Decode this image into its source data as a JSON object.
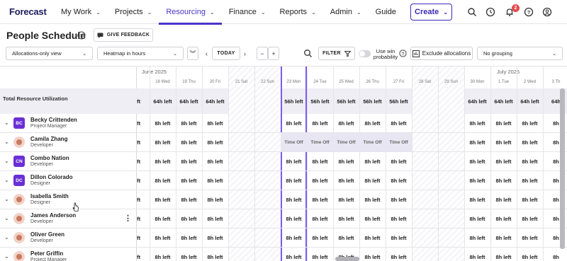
{
  "app": {
    "logo": "Forecast"
  },
  "nav": [
    {
      "label": "My Work",
      "has_dropdown": true
    },
    {
      "label": "Projects",
      "has_dropdown": true
    },
    {
      "label": "Resourcing",
      "has_dropdown": true,
      "active": true
    },
    {
      "label": "Finance",
      "has_dropdown": true
    },
    {
      "label": "Reports",
      "has_dropdown": true
    },
    {
      "label": "Admin",
      "has_dropdown": true
    },
    {
      "label": "Guide",
      "has_dropdown": false
    }
  ],
  "header": {
    "create_label": "Create",
    "notification_count": "2",
    "icons": [
      "search-icon",
      "timer-icon",
      "bell-icon",
      "help-icon",
      "user-icon"
    ]
  },
  "page": {
    "title": "People Schedule",
    "feedback_label": "GIVE FEEDBACK"
  },
  "toolbar": {
    "view_select": "Allocations-only view",
    "heatmap_select": "Heatmap in hours",
    "today_label": "TODAY",
    "zoom_out": "−",
    "zoom_in": "+",
    "filter_label": "FILTER",
    "win_probability_label": "Use win probability",
    "exclude_label": "Exclude allocations",
    "grouping_select": "No grouping"
  },
  "schedule": {
    "months": [
      {
        "label": "June 2025"
      },
      {
        "label": "July 2025"
      }
    ],
    "days": [
      {
        "label": "",
        "weekend": false
      },
      {
        "label": "18 Wed",
        "weekend": false
      },
      {
        "label": "19 Thu",
        "weekend": false
      },
      {
        "label": "20 Fri",
        "weekend": false
      },
      {
        "label": "21 Sat",
        "weekend": true
      },
      {
        "label": "22 Sun",
        "weekend": true
      },
      {
        "label": "23 Mon",
        "weekend": false,
        "today": true
      },
      {
        "label": "24 Tue",
        "weekend": false
      },
      {
        "label": "25 Wed",
        "weekend": false
      },
      {
        "label": "26 Thu",
        "weekend": false
      },
      {
        "label": "27 Fri",
        "weekend": false
      },
      {
        "label": "28 Sat",
        "weekend": true
      },
      {
        "label": "29 Sun",
        "weekend": true
      },
      {
        "label": "30 Mon",
        "weekend": false
      },
      {
        "label": "1 Tue",
        "weekend": false
      },
      {
        "label": "2 Wed",
        "weekend": false
      },
      {
        "label": "3 Th",
        "weekend": false
      }
    ],
    "total_label": "Total Resource Utilization",
    "total_row": [
      "left",
      "64h left",
      "64h left",
      "64h left",
      "",
      "",
      "56h left",
      "56h left",
      "56h left",
      "56h left",
      "56h left",
      "",
      "",
      "64h left",
      "64h left",
      "64h left",
      "64h"
    ],
    "people": [
      {
        "name": "Becky Crittenden",
        "role": "Project Manager",
        "initials": "BC",
        "avatar": "hex",
        "cells": [
          "left",
          "8h left",
          "8h left",
          "8h left",
          "",
          "",
          "8h left",
          "8h left",
          "8h left",
          "8h left",
          "8h left",
          "",
          "",
          "8h left",
          "8h left",
          "8h left",
          "8h"
        ]
      },
      {
        "name": "Camila Zhang",
        "role": "Developer",
        "initials": "",
        "avatar": "photo",
        "cells": [
          "left",
          "8h left",
          "8h left",
          "8h left",
          "",
          "",
          "Time Off",
          "Time Off",
          "Time Off",
          "Time Off",
          "Time Off",
          "",
          "",
          "8h left",
          "8h left",
          "8h left",
          "8h"
        ]
      },
      {
        "name": "Combo Nation",
        "role": "Developer",
        "initials": "CN",
        "avatar": "hex",
        "cells": [
          "left",
          "8h left",
          "8h left",
          "8h left",
          "",
          "",
          "8h left",
          "8h left",
          "8h left",
          "8h left",
          "8h left",
          "",
          "",
          "8h left",
          "8h left",
          "8h left",
          "8h"
        ]
      },
      {
        "name": "Dillon Colorado",
        "role": "Designer",
        "initials": "DC",
        "avatar": "hex",
        "cells": [
          "left",
          "8h left",
          "8h left",
          "8h left",
          "",
          "",
          "8h left",
          "8h left",
          "8h left",
          "8h left",
          "8h left",
          "",
          "",
          "8h left",
          "8h left",
          "8h left",
          "8h"
        ]
      },
      {
        "name": "Isabella Smith",
        "role": "Designer",
        "initials": "",
        "avatar": "photo",
        "cells": [
          "left",
          "8h left",
          "8h left",
          "8h left",
          "",
          "",
          "8h left",
          "8h left",
          "8h left",
          "8h left",
          "8h left",
          "",
          "",
          "8h left",
          "8h left",
          "8h left",
          "8h"
        ]
      },
      {
        "name": "James Anderson",
        "role": "Developer",
        "initials": "",
        "avatar": "photo",
        "show_menu": true,
        "cells": [
          "left",
          "8h left",
          "8h left",
          "8h left",
          "",
          "",
          "8h left",
          "8h left",
          "8h left",
          "8h left",
          "8h left",
          "",
          "",
          "8h left",
          "8h left",
          "8h left",
          "8h"
        ]
      },
      {
        "name": "Oliver Green",
        "role": "Developer",
        "initials": "",
        "avatar": "photo",
        "cells": [
          "left",
          "8h left",
          "8h left",
          "8h left",
          "",
          "",
          "8h left",
          "8h left",
          "8h left",
          "8h left",
          "8h left",
          "",
          "",
          "8h left",
          "8h left",
          "8h left",
          "8h"
        ]
      },
      {
        "name": "Peter Griffin",
        "role": "Project Manager",
        "initials": "",
        "avatar": "photo",
        "cells": [
          "left",
          "8h left",
          "8h left",
          "8h left",
          "",
          "",
          "8h left",
          "8h left",
          "8h left",
          "8h left",
          "8h left",
          "",
          "",
          "8h left",
          "8h left",
          "8h left",
          "8h"
        ]
      }
    ]
  },
  "colors": {
    "brand": "#1e1b5c",
    "accent": "#4a35c9",
    "today": "#7a5cf0",
    "avatar_hex": "#6b2fd6",
    "badge": "#e5484d"
  }
}
